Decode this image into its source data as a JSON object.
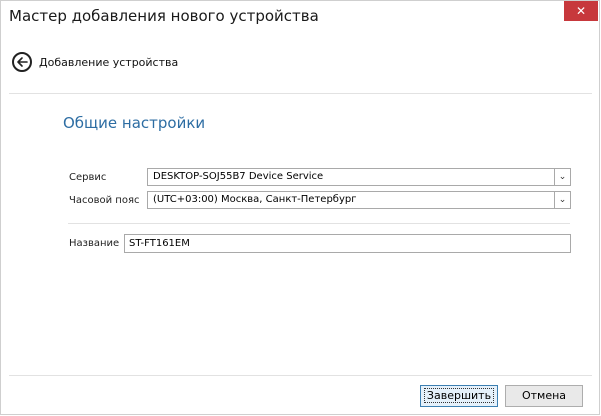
{
  "window": {
    "title": "Мастер добавления нового устройства",
    "close_glyph": "✕"
  },
  "header": {
    "back_icon": "back-arrow-circle-icon",
    "label": "Добавление устройства"
  },
  "section": {
    "title": "Общие настройки"
  },
  "form": {
    "service_label": "Сервис",
    "service_value": "DESKTOP-SOJ55B7 Device Service",
    "timezone_label": "Часовой пояс",
    "timezone_value": "(UTC+03:00) Москва, Санкт-Петербург",
    "name_label": "Название",
    "name_value": "ST-FT161EM",
    "dropdown_glyph": "⌄"
  },
  "footer": {
    "finish_label": "Завершить",
    "cancel_label": "Отмена"
  },
  "colors": {
    "accent_title": "#2d6da3",
    "close_bg": "#c7383c"
  }
}
